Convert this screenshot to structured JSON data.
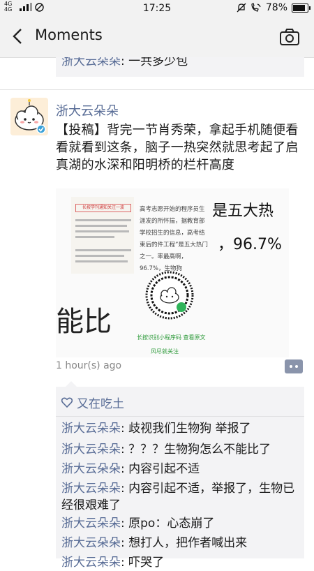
{
  "status_bar": {
    "network": "4G 4G",
    "time": "17:25",
    "battery": "78%",
    "battery_level": 0.78
  },
  "nav": {
    "title": "Moments"
  },
  "previous_comment": {
    "user": "浙大云朵朵",
    "text": ": 一共多少包"
  },
  "post": {
    "author": "浙大云朵朵",
    "text": "【投稿】背完一节肖秀荣，拿起手机随便看看就看到这条，脑子一热突然就思考起了启真湖的水深和阳明桥的栏杆高度",
    "timestamp": "1 hour(s) ago",
    "image": {
      "red_title": "长按学刊通知关注一波",
      "mid_text": "高考志愿开始的程序员生涯发的所怀揣，据教育部学校招生的信息，高考结束后的件工程”是五大热门之一。率最高啊，96.7%，生物狗",
      "big_right_1": "是五大热",
      "big_right_2": "，96.7%",
      "big_bottom": "能比",
      "green_caption": "长按识别小程序码 查看原文",
      "green_caption2": "风尽就关注"
    }
  },
  "likes": {
    "names": "又在吃土"
  },
  "comments": [
    {
      "user": "浙大云朵朵",
      "text": ": 歧视我们生物狗 举报了"
    },
    {
      "user": "浙大云朵朵",
      "text": ": ？？？生物狗怎么不能比了"
    },
    {
      "user": "浙大云朵朵",
      "text": ": 内容引起不适"
    },
    {
      "user": "浙大云朵朵",
      "text": ": 内容引起不适，举报了，生物已经很艰难了"
    },
    {
      "user": "浙大云朵朵",
      "text": ": 原po：心态崩了"
    },
    {
      "user": "浙大云朵朵",
      "text": ": 想打人，把作者喊出来"
    },
    {
      "user": "浙大云朵朵",
      "text": ": 吓哭了"
    }
  ],
  "colors": {
    "link": "#576b95",
    "nav_bg": "#f2f2f2",
    "comment_bg": "#f3f3f5"
  }
}
